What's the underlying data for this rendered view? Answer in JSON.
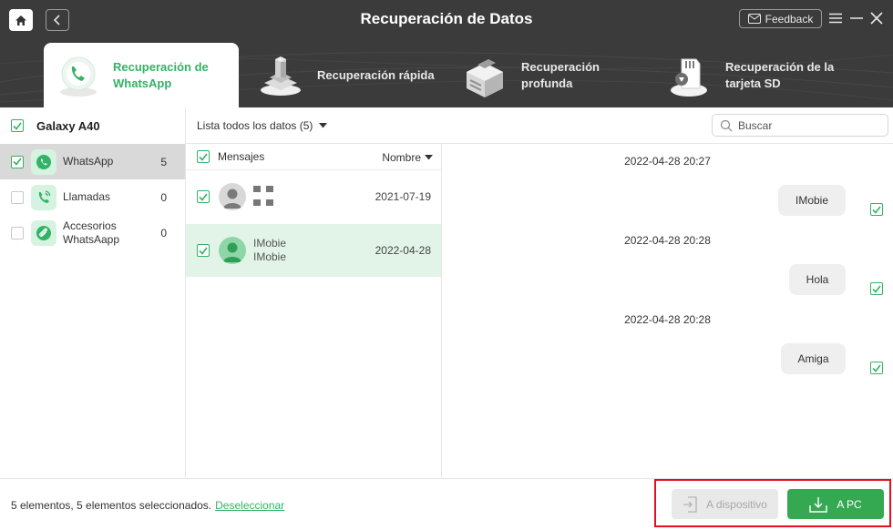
{
  "app": {
    "title": "Recuperación de Datos",
    "feedback_label": "Feedback"
  },
  "tabs": [
    {
      "label": "Recuperación de WhatsApp",
      "active": true,
      "icon": "phone-icon"
    },
    {
      "label": "Recuperación rápida",
      "active": false,
      "icon": "chip-stack-icon"
    },
    {
      "label": "Recuperación profunda",
      "active": false,
      "icon": "box-stack-icon"
    },
    {
      "label": "Recuperación de la tarjeta SD",
      "active": false,
      "icon": "sd-card-icon"
    }
  ],
  "sidebar": {
    "device": "Galaxy A40",
    "items": [
      {
        "label": "WhatsApp",
        "count": "5",
        "checked": true,
        "selected": true
      },
      {
        "label": "Llamadas",
        "count": "0",
        "checked": false,
        "selected": false
      },
      {
        "label": "Accesorios WhatsAapp",
        "count": "0",
        "checked": false,
        "selected": false
      }
    ]
  },
  "toolbar": {
    "filter_label": "Lista todos los datos (5)",
    "search_placeholder": "Buscar"
  },
  "list": {
    "header_label": "Mensajes",
    "sort_label": "Nombre",
    "rows": [
      {
        "name": "",
        "date": "2021-07-19",
        "checked": true,
        "selected": false
      },
      {
        "name": "IMobie",
        "subname": "IMobie",
        "date": "2022-04-28",
        "checked": true,
        "selected": true
      }
    ]
  },
  "chat": {
    "messages": [
      {
        "time": "2022-04-28 20:27",
        "text": "IMobie",
        "checked": true
      },
      {
        "time": "2022-04-28 20:28",
        "text": "Hola",
        "checked": true
      },
      {
        "time": "2022-04-28 20:28",
        "text": "Amiga",
        "checked": true
      }
    ]
  },
  "footer": {
    "status": "5 elementos, 5 elementos seleccionados.",
    "deselect_label": "Deseleccionar",
    "to_device_label": "A dispositivo",
    "to_pc_label": "A PC"
  },
  "colors": {
    "accent": "#34b266",
    "header_bg": "#3b3b3b",
    "highlight": "#e3101b"
  }
}
